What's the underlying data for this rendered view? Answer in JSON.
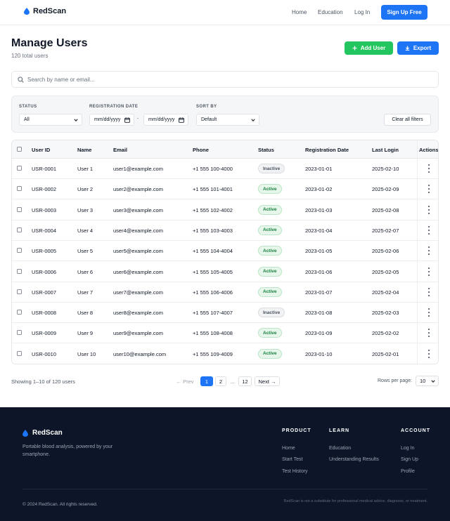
{
  "brand": {
    "name": "RedScan",
    "accent": "#1d74f5",
    "drop_color": "#1d74f5"
  },
  "nav": {
    "links": [
      "Home",
      "Education",
      "Log In"
    ],
    "cta": "Sign Up Free"
  },
  "header": {
    "title": "Manage Users",
    "subtitle": "120 total users",
    "add_label": "Add User",
    "export_label": "Export"
  },
  "search": {
    "placeholder": "Search by name or email..."
  },
  "filters": {
    "status_label": "STATUS",
    "status_value": "All",
    "date_label": "REGISTRATION DATE",
    "date_from": "mm/dd/yyyy",
    "date_to": "mm/dd/yyyy",
    "date_sep": "-",
    "sort_label": "SORT BY",
    "sort_value": "Default",
    "clear_label": "Clear all filters"
  },
  "table": {
    "columns": [
      "User ID",
      "Name",
      "Email",
      "Phone",
      "Status",
      "Registration Date",
      "Last Login",
      "Actions"
    ],
    "rows": [
      {
        "id": "USR-0001",
        "name": "User 1",
        "email": "user1@example.com",
        "phone": "+1 555 100-4000",
        "status": "Inactive",
        "reg": "2023-01-01",
        "login": "2025-02-10"
      },
      {
        "id": "USR-0002",
        "name": "User 2",
        "email": "user2@example.com",
        "phone": "+1 555 101-4001",
        "status": "Active",
        "reg": "2023-01-02",
        "login": "2025-02-09"
      },
      {
        "id": "USR-0003",
        "name": "User 3",
        "email": "user3@example.com",
        "phone": "+1 555 102-4002",
        "status": "Active",
        "reg": "2023-01-03",
        "login": "2025-02-08"
      },
      {
        "id": "USR-0004",
        "name": "User 4",
        "email": "user4@example.com",
        "phone": "+1 555 103-4003",
        "status": "Active",
        "reg": "2023-01-04",
        "login": "2025-02-07"
      },
      {
        "id": "USR-0005",
        "name": "User 5",
        "email": "user5@example.com",
        "phone": "+1 555 104-4004",
        "status": "Active",
        "reg": "2023-01-05",
        "login": "2025-02-06"
      },
      {
        "id": "USR-0006",
        "name": "User 6",
        "email": "user6@example.com",
        "phone": "+1 555 105-4005",
        "status": "Active",
        "reg": "2023-01-06",
        "login": "2025-02-05"
      },
      {
        "id": "USR-0007",
        "name": "User 7",
        "email": "user7@example.com",
        "phone": "+1 555 106-4006",
        "status": "Active",
        "reg": "2023-01-07",
        "login": "2025-02-04"
      },
      {
        "id": "USR-0008",
        "name": "User 8",
        "email": "user8@example.com",
        "phone": "+1 555 107-4007",
        "status": "Inactive",
        "reg": "2023-01-08",
        "login": "2025-02-03"
      },
      {
        "id": "USR-0009",
        "name": "User 9",
        "email": "user9@example.com",
        "phone": "+1 555 108-4008",
        "status": "Active",
        "reg": "2023-01-09",
        "login": "2025-02-02"
      },
      {
        "id": "USR-0010",
        "name": "User 10",
        "email": "user10@example.com",
        "phone": "+1 555 109-4009",
        "status": "Active",
        "reg": "2023-01-10",
        "login": "2025-02-01"
      }
    ]
  },
  "pagination": {
    "showing": "Showing 1–10 of 120 users",
    "prev": "← Prev",
    "pages": [
      "1",
      "2",
      "...",
      "12"
    ],
    "current": "1",
    "next": "Next →",
    "rows_label": "Rows per page:",
    "rows_value": "10"
  },
  "footer": {
    "tagline": "Portable blood analysis, powered by your smartphone.",
    "columns": [
      {
        "title": "PRODUCT",
        "links": [
          "Home",
          "Start Test",
          "Test History"
        ]
      },
      {
        "title": "LEARN",
        "links": [
          "Education",
          "Understanding Results"
        ]
      },
      {
        "title": "ACCOUNT",
        "links": [
          "Log In",
          "Sign Up",
          "Profile"
        ]
      }
    ],
    "copyright": "© 2024 RedScan. All rights reserved.",
    "disclaimer": "RedScan is not a substitute for professional medical advice, diagnosis, or treatment."
  },
  "colors": {
    "active_text": "#15803d",
    "inactive_text": "#4b5563",
    "green": "#22c55e",
    "footer_bg": "#0c1628"
  }
}
